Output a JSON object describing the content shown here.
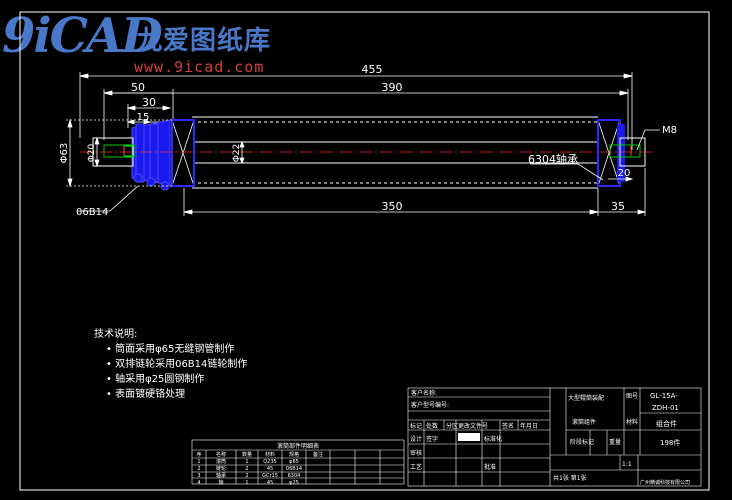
{
  "watermark": {
    "logo": "9iCAD",
    "site_name": "九爱图纸库",
    "url": "www.9icad.com"
  },
  "dimensions": {
    "overall_length": "455",
    "tube_length": "390",
    "bearing_span": "350",
    "shaft_end": "50",
    "sprocket_offset": "30",
    "sprocket_width": "15",
    "end_right": "35",
    "end_right_inner": "20",
    "tube_diameter": "Φ63",
    "shaft_diameter": "Φ20",
    "inner_diameter": "Φ22"
  },
  "callouts": {
    "sprocket": "06B14",
    "bearing": "6304轴承",
    "thread": "M8"
  },
  "notes": {
    "heading": "技术说明:",
    "items": [
      "筒面采用φ65无缝钢管制作",
      "双排链轮采用06B14链轮制作",
      "轴采用φ25圆钢制作",
      "表面镀硬铬处理"
    ]
  },
  "title_block": {
    "drawing_no_label": "图号",
    "drawing_no": "GL-15A-",
    "part_no": "ZDH-01",
    "material_label": "材料",
    "material": "组合件",
    "weight_label": "重量",
    "weight": "198件",
    "scale": "1:1",
    "sheet": "共1张 第1张",
    "company": "广州精诚科技有限公司",
    "part_name": "大型辊筒装配",
    "sub_name": "滚筒组件",
    "stage_label": "阶段标记",
    "row_labels": [
      "标记",
      "处数",
      "分区",
      "更改文件号",
      "签名",
      "年月日"
    ],
    "roles": [
      "设计",
      "标准化",
      "审核",
      "工艺",
      "批准"
    ],
    "top_labels": [
      "客户名称:",
      "客户型号编号:"
    ],
    "approve": "签字"
  },
  "bom": {
    "title": "滚筒部件明细表",
    "header": [
      "序",
      "名称",
      "数量",
      "材料",
      "规格",
      "备注"
    ],
    "rows": [
      [
        "1",
        "滚筒",
        "1",
        "Q235",
        "φ65",
        ""
      ],
      [
        "2",
        "链轮",
        "2",
        "45",
        "06B14",
        ""
      ],
      [
        "3",
        "轴承",
        "2",
        "GCr15",
        "6304",
        ""
      ],
      [
        "4",
        "轴",
        "1",
        "45",
        "φ25",
        ""
      ]
    ]
  },
  "colors": {
    "background": "#000000",
    "lines": "#ffffff",
    "part": "#2a2aff",
    "centerline": "#ff3030",
    "accent": "#00c8c8",
    "shaft": "#00ff00"
  }
}
